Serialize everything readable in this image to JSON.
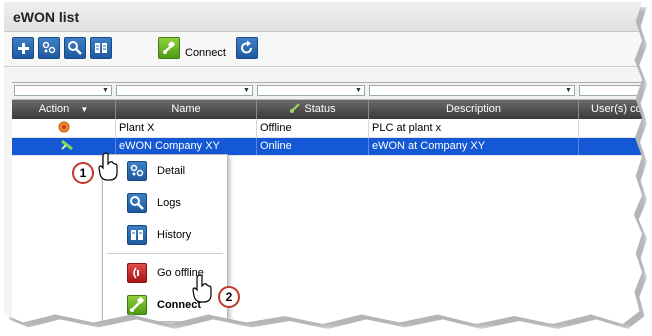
{
  "window": {
    "title": "eWON list"
  },
  "toolbar": {
    "connect_label": "Connect",
    "buttons": [
      "add-icon",
      "groups-icon",
      "search-icon",
      "book-icon",
      "connect-icon",
      "refresh-icon"
    ]
  },
  "table": {
    "columns": [
      "Action",
      "Name",
      "Status",
      "Description",
      "User(s) co"
    ],
    "rows": [
      {
        "name": "Plant X",
        "status": "Offline",
        "description": "PLC at plant x",
        "selected": false
      },
      {
        "name": "eWON Company XY",
        "status": "Online",
        "description": "eWON at Company XY",
        "selected": true
      }
    ]
  },
  "context_menu": {
    "items": [
      {
        "label": "Detail",
        "icon": "groups-icon"
      },
      {
        "label": "Logs",
        "icon": "search-icon"
      },
      {
        "label": "History",
        "icon": "book-icon"
      },
      {
        "label": "Go offline",
        "icon": "go-offline-icon"
      },
      {
        "label": "Connect",
        "icon": "connect-icon"
      }
    ]
  },
  "callouts": [
    "1",
    "2"
  ],
  "colors": {
    "selection": "#1558d6",
    "button_blue": "#2a6ab5",
    "button_green": "#6ab52a",
    "callout_border": "#c0392b"
  }
}
